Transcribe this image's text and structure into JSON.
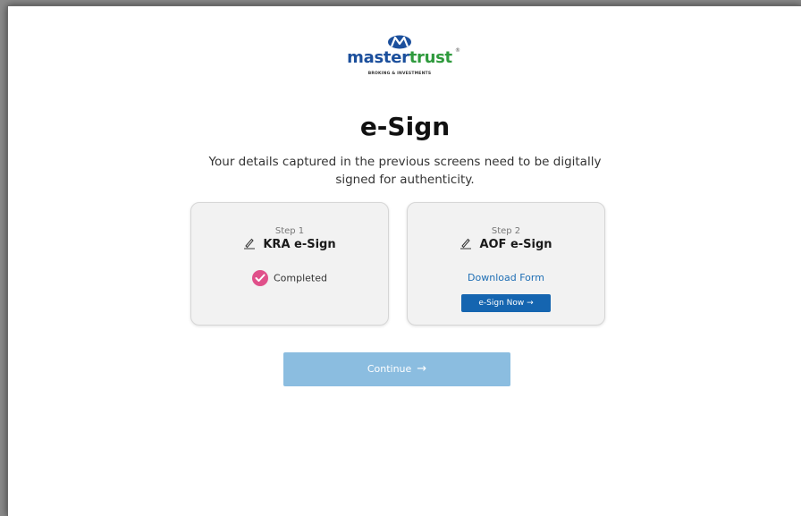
{
  "brand": {
    "name_part1": "master",
    "name_part2": "trust",
    "tagline": "BROKING & INVESTMENTS",
    "registered": "®",
    "primary_color": "#1b4f9c",
    "secondary_color": "#2f9a3d"
  },
  "page": {
    "title": "e-Sign",
    "subtitle": "Your details captured in the previous screens need to be digitally signed for authenticity."
  },
  "steps": [
    {
      "step_label": "Step 1",
      "title": "KRA e-Sign",
      "icon": "pen-sign-icon",
      "status": "Completed",
      "status_color": "#e0508a"
    },
    {
      "step_label": "Step 2",
      "title": "AOF e-Sign",
      "icon": "pen-sign-icon",
      "link_label": "Download Form",
      "button_label": "e-Sign Now →",
      "button_color": "#1565b0"
    }
  ],
  "actions": {
    "continue_label": "Continue",
    "continue_arrow": "→",
    "continue_color": "#8bbde0"
  }
}
